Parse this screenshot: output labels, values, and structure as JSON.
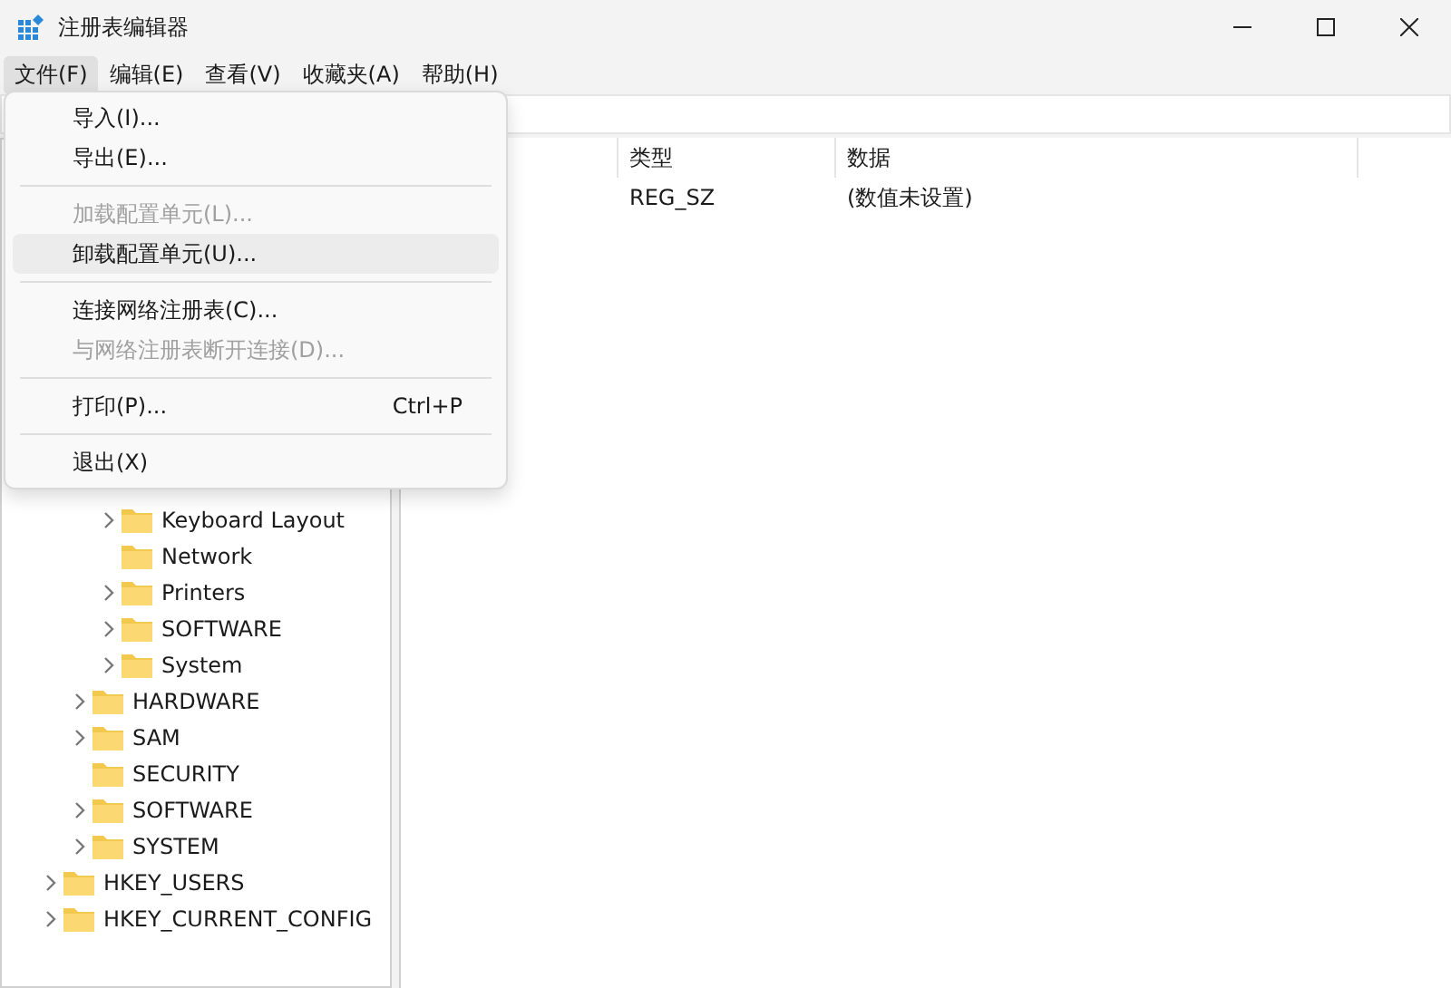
{
  "window": {
    "title": "注册表编辑器"
  },
  "menubar": [
    {
      "label": "文件(F)",
      "selected": true
    },
    {
      "label": "编辑(E)",
      "selected": false
    },
    {
      "label": "查看(V)",
      "selected": false
    },
    {
      "label": "收藏夹(A)",
      "selected": false
    },
    {
      "label": "帮助(H)",
      "selected": false
    }
  ],
  "file_menu": [
    {
      "kind": "item",
      "label": "导入(I)...",
      "disabled": false,
      "selected": false
    },
    {
      "kind": "item",
      "label": "导出(E)...",
      "disabled": false,
      "selected": false
    },
    {
      "kind": "separator"
    },
    {
      "kind": "item",
      "label": "加载配置单元(L)...",
      "disabled": true,
      "selected": false
    },
    {
      "kind": "item",
      "label": "卸载配置单元(U)...",
      "disabled": false,
      "selected": true
    },
    {
      "kind": "separator"
    },
    {
      "kind": "item",
      "label": "连接网络注册表(C)...",
      "disabled": false,
      "selected": false
    },
    {
      "kind": "item",
      "label": "与网络注册表断开连接(D)...",
      "disabled": true,
      "selected": false
    },
    {
      "kind": "separator"
    },
    {
      "kind": "item",
      "label": "打印(P)...",
      "shortcut": "Ctrl+P",
      "disabled": false,
      "selected": false
    },
    {
      "kind": "separator"
    },
    {
      "kind": "item",
      "label": "退出(X)",
      "disabled": false,
      "selected": false
    }
  ],
  "tree": [
    {
      "children": [
        {
          "children": [
            {
              "label": "Keyboard Layout",
              "expandable": true
            },
            {
              "label": "Network",
              "expandable": false
            },
            {
              "label": "Printers",
              "expandable": true
            },
            {
              "label": "SOFTWARE",
              "expandable": true
            },
            {
              "label": "System",
              "expandable": true
            }
          ]
        },
        {
          "label": "HARDWARE",
          "expandable": true
        },
        {
          "label": "SAM",
          "expandable": true
        },
        {
          "label": "SECURITY",
          "expandable": false
        },
        {
          "label": "SOFTWARE",
          "expandable": true
        },
        {
          "label": "SYSTEM",
          "expandable": true
        }
      ]
    },
    {
      "label": "HKEY_USERS",
      "expandable": true
    },
    {
      "label": "HKEY_CURRENT_CONFIG",
      "expandable": true
    }
  ],
  "table": {
    "columns": [
      "类型",
      "数据"
    ],
    "rows": [
      [
        "REG_SZ",
        "(数值未设置)"
      ]
    ]
  }
}
